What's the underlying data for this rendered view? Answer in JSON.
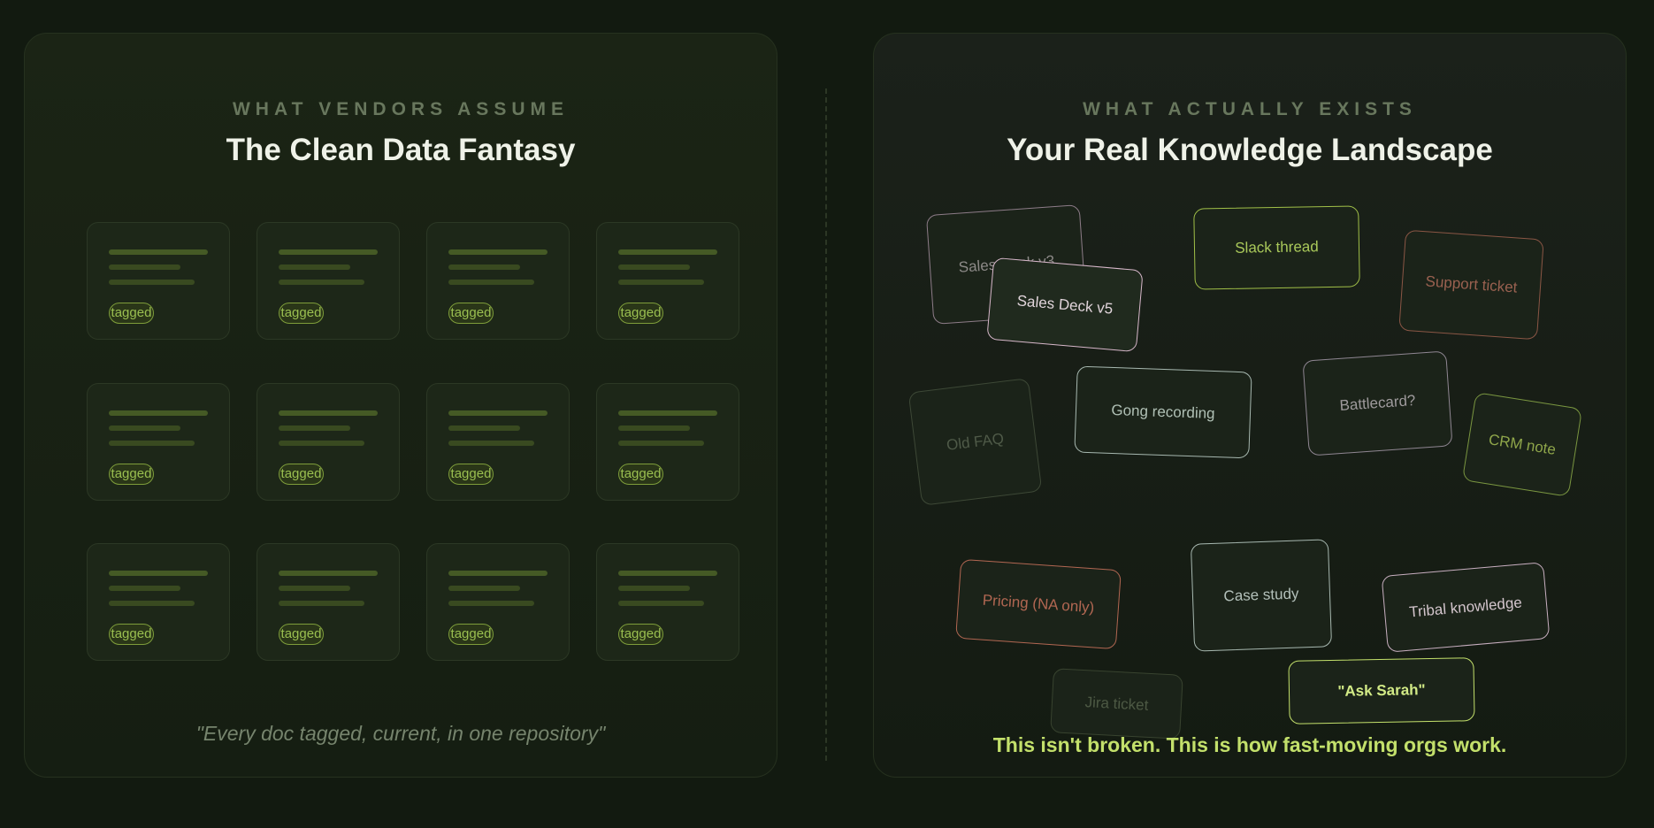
{
  "left": {
    "eyebrow": "WHAT VENDORS ASSUME",
    "title": "The Clean Data Fantasy",
    "tag_label": "tagged",
    "quote": "\"Every doc tagged, current, in one repository\""
  },
  "right": {
    "eyebrow": "WHAT ACTUALLY EXISTS",
    "title": "Your Real Knowledge Landscape",
    "chips": {
      "sales_deck_v3": "Sales Deck v3",
      "sales_deck_v5": "Sales Deck v5",
      "slack_thread": "Slack thread",
      "support_ticket": "Support ticket",
      "old_faq": "Old FAQ",
      "gong_recording": "Gong recording",
      "battlecard": "Battlecard?",
      "crm_note": "CRM note",
      "pricing": "Pricing (NA only)",
      "case_study": "Case study",
      "tribal_knowledge": "Tribal knowledge",
      "jira_ticket": "Jira ticket",
      "ask_sarah": "\"Ask Sarah\""
    },
    "footer": "This isn't broken. This is how fast-moving orgs work."
  },
  "colors": {
    "background": "#121a10",
    "accent_green": "#c3e06b",
    "tag_green": "#9abf50",
    "pink": "#d8b8cb",
    "rust": "#b26752",
    "teal_gray": "#a7b8b0",
    "olive": "#8fa64a"
  }
}
